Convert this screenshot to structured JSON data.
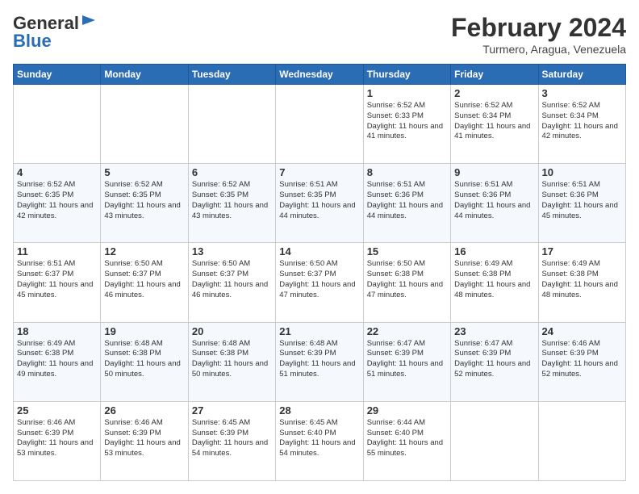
{
  "header": {
    "logo_line1": "General",
    "logo_line2": "Blue",
    "month_title": "February 2024",
    "location": "Turmero, Aragua, Venezuela"
  },
  "days_of_week": [
    "Sunday",
    "Monday",
    "Tuesday",
    "Wednesday",
    "Thursday",
    "Friday",
    "Saturday"
  ],
  "weeks": [
    [
      {
        "day": "",
        "info": ""
      },
      {
        "day": "",
        "info": ""
      },
      {
        "day": "",
        "info": ""
      },
      {
        "day": "",
        "info": ""
      },
      {
        "day": "1",
        "info": "Sunrise: 6:52 AM\nSunset: 6:33 PM\nDaylight: 11 hours and 41 minutes."
      },
      {
        "day": "2",
        "info": "Sunrise: 6:52 AM\nSunset: 6:34 PM\nDaylight: 11 hours and 41 minutes."
      },
      {
        "day": "3",
        "info": "Sunrise: 6:52 AM\nSunset: 6:34 PM\nDaylight: 11 hours and 42 minutes."
      }
    ],
    [
      {
        "day": "4",
        "info": "Sunrise: 6:52 AM\nSunset: 6:35 PM\nDaylight: 11 hours and 42 minutes."
      },
      {
        "day": "5",
        "info": "Sunrise: 6:52 AM\nSunset: 6:35 PM\nDaylight: 11 hours and 43 minutes."
      },
      {
        "day": "6",
        "info": "Sunrise: 6:52 AM\nSunset: 6:35 PM\nDaylight: 11 hours and 43 minutes."
      },
      {
        "day": "7",
        "info": "Sunrise: 6:51 AM\nSunset: 6:35 PM\nDaylight: 11 hours and 44 minutes."
      },
      {
        "day": "8",
        "info": "Sunrise: 6:51 AM\nSunset: 6:36 PM\nDaylight: 11 hours and 44 minutes."
      },
      {
        "day": "9",
        "info": "Sunrise: 6:51 AM\nSunset: 6:36 PM\nDaylight: 11 hours and 44 minutes."
      },
      {
        "day": "10",
        "info": "Sunrise: 6:51 AM\nSunset: 6:36 PM\nDaylight: 11 hours and 45 minutes."
      }
    ],
    [
      {
        "day": "11",
        "info": "Sunrise: 6:51 AM\nSunset: 6:37 PM\nDaylight: 11 hours and 45 minutes."
      },
      {
        "day": "12",
        "info": "Sunrise: 6:50 AM\nSunset: 6:37 PM\nDaylight: 11 hours and 46 minutes."
      },
      {
        "day": "13",
        "info": "Sunrise: 6:50 AM\nSunset: 6:37 PM\nDaylight: 11 hours and 46 minutes."
      },
      {
        "day": "14",
        "info": "Sunrise: 6:50 AM\nSunset: 6:37 PM\nDaylight: 11 hours and 47 minutes."
      },
      {
        "day": "15",
        "info": "Sunrise: 6:50 AM\nSunset: 6:38 PM\nDaylight: 11 hours and 47 minutes."
      },
      {
        "day": "16",
        "info": "Sunrise: 6:49 AM\nSunset: 6:38 PM\nDaylight: 11 hours and 48 minutes."
      },
      {
        "day": "17",
        "info": "Sunrise: 6:49 AM\nSunset: 6:38 PM\nDaylight: 11 hours and 48 minutes."
      }
    ],
    [
      {
        "day": "18",
        "info": "Sunrise: 6:49 AM\nSunset: 6:38 PM\nDaylight: 11 hours and 49 minutes."
      },
      {
        "day": "19",
        "info": "Sunrise: 6:48 AM\nSunset: 6:38 PM\nDaylight: 11 hours and 50 minutes."
      },
      {
        "day": "20",
        "info": "Sunrise: 6:48 AM\nSunset: 6:38 PM\nDaylight: 11 hours and 50 minutes."
      },
      {
        "day": "21",
        "info": "Sunrise: 6:48 AM\nSunset: 6:39 PM\nDaylight: 11 hours and 51 minutes."
      },
      {
        "day": "22",
        "info": "Sunrise: 6:47 AM\nSunset: 6:39 PM\nDaylight: 11 hours and 51 minutes."
      },
      {
        "day": "23",
        "info": "Sunrise: 6:47 AM\nSunset: 6:39 PM\nDaylight: 11 hours and 52 minutes."
      },
      {
        "day": "24",
        "info": "Sunrise: 6:46 AM\nSunset: 6:39 PM\nDaylight: 11 hours and 52 minutes."
      }
    ],
    [
      {
        "day": "25",
        "info": "Sunrise: 6:46 AM\nSunset: 6:39 PM\nDaylight: 11 hours and 53 minutes."
      },
      {
        "day": "26",
        "info": "Sunrise: 6:46 AM\nSunset: 6:39 PM\nDaylight: 11 hours and 53 minutes."
      },
      {
        "day": "27",
        "info": "Sunrise: 6:45 AM\nSunset: 6:39 PM\nDaylight: 11 hours and 54 minutes."
      },
      {
        "day": "28",
        "info": "Sunrise: 6:45 AM\nSunset: 6:40 PM\nDaylight: 11 hours and 54 minutes."
      },
      {
        "day": "29",
        "info": "Sunrise: 6:44 AM\nSunset: 6:40 PM\nDaylight: 11 hours and 55 minutes."
      },
      {
        "day": "",
        "info": ""
      },
      {
        "day": "",
        "info": ""
      }
    ]
  ]
}
